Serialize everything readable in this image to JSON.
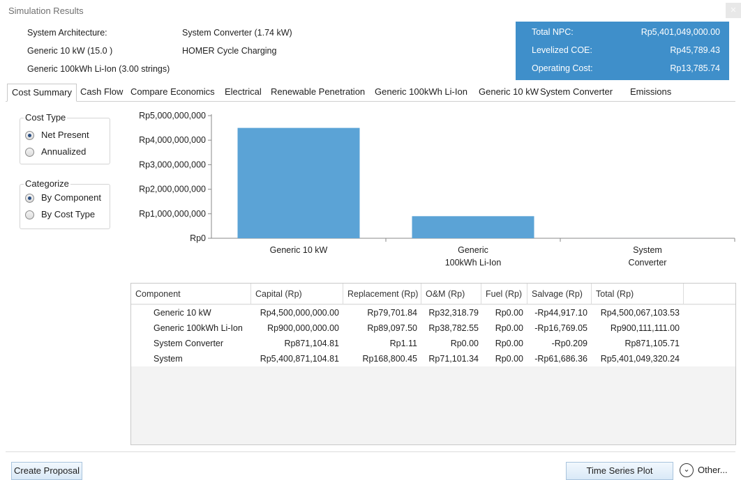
{
  "window": {
    "title": "Simulation Results",
    "close_label": "✕"
  },
  "architecture": {
    "label": "System Architecture:",
    "items": [
      "Generic 10 kW (15.0 )",
      "Generic 100kWh Li-Ion (3.00 strings)"
    ],
    "col2": [
      "System Converter (1.74 kW)",
      "HOMER Cycle Charging"
    ]
  },
  "summary": {
    "total_npc_label": "Total NPC:",
    "total_npc_value": "Rp5,401,049,000.00",
    "lcoe_label": "Levelized COE:",
    "lcoe_value": "Rp45,789.43",
    "opcost_label": "Operating Cost:",
    "opcost_value": "Rp13,785.74",
    "color": "#3f8fca"
  },
  "tabs": [
    {
      "label": "Cost Summary",
      "active": true
    },
    {
      "label": "Cash Flow"
    },
    {
      "label": "Compare Economics"
    },
    {
      "label": "Electrical"
    },
    {
      "label": "Renewable Penetration"
    },
    {
      "label": "Generic 100kWh Li-Ion"
    },
    {
      "label": "Generic 10 kW"
    },
    {
      "label": "System Converter"
    },
    {
      "label": "Emissions"
    }
  ],
  "cost_type": {
    "title": "Cost Type",
    "options": [
      {
        "label": "Net Present",
        "selected": true
      },
      {
        "label": "Annualized",
        "selected": false
      }
    ]
  },
  "categorize": {
    "title": "Categorize",
    "options": [
      {
        "label": "By Component",
        "selected": true
      },
      {
        "label": "By Cost Type",
        "selected": false
      }
    ]
  },
  "chart_data": {
    "type": "bar",
    "categories": [
      [
        "Generic 10 kW"
      ],
      [
        "Generic",
        "100kWh Li-Ion"
      ],
      [
        "System",
        "Converter"
      ]
    ],
    "values": [
      4500067103.53,
      900111111.0,
      871105.71
    ],
    "y_ticks": [
      "Rp0",
      "Rp1,000,000,000",
      "Rp2,000,000,000",
      "Rp3,000,000,000",
      "Rp4,000,000,000",
      "Rp5,000,000,000"
    ],
    "ylim": [
      0,
      5000000000
    ],
    "bar_color": "#5ba3d6",
    "grid": false
  },
  "table": {
    "columns": [
      "Component",
      "Capital (Rp)",
      "Replacement (Rp)",
      "O&M (Rp)",
      "Fuel (Rp)",
      "Salvage (Rp)",
      "Total (Rp)"
    ],
    "rows": [
      [
        "Generic 10 kW",
        "Rp4,500,000,000.00",
        "Rp79,701.84",
        "Rp32,318.79",
        "Rp0.00",
        "-Rp44,917.10",
        "Rp4,500,067,103.53"
      ],
      [
        "Generic 100kWh Li-Ion",
        "Rp900,000,000.00",
        "Rp89,097.50",
        "Rp38,782.55",
        "Rp0.00",
        "-Rp16,769.05",
        "Rp900,111,111.00"
      ],
      [
        "System Converter",
        "Rp871,104.81",
        "Rp1.11",
        "Rp0.00",
        "Rp0.00",
        "-Rp0.209",
        "Rp871,105.71"
      ],
      [
        "System",
        "Rp5,400,871,104.81",
        "Rp168,800.45",
        "Rp71,101.34",
        "Rp0.00",
        "-Rp61,686.36",
        "Rp5,401,049,320.24"
      ]
    ]
  },
  "buttons": {
    "create_proposal": "Create Proposal",
    "time_series_plot": "Time Series Plot",
    "other": "Other...",
    "other_icon": "chevron-down-circle-icon"
  }
}
